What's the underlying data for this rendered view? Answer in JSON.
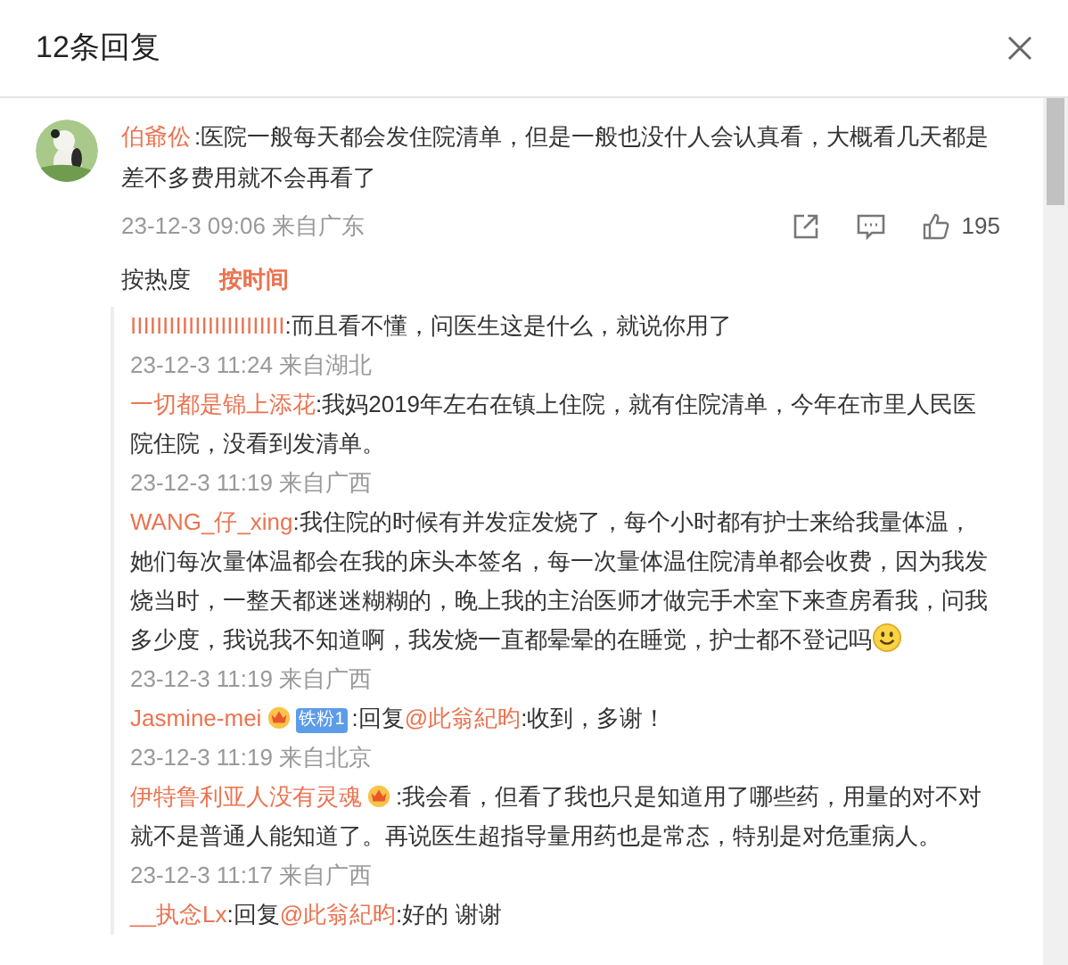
{
  "header": {
    "title": "12条回复"
  },
  "comment": {
    "name": "伯爺伀",
    "text": ":医院一般每天都会发住院清单，但是一般也没什人会认真看，大概看几天都是差不多费用就不会再看了",
    "time": "23-12-3 09:06 来自广东",
    "likes": "195"
  },
  "sort_tabs": [
    {
      "label": "按热度",
      "selected": false
    },
    {
      "label": "按时间",
      "selected": true
    }
  ],
  "replies": [
    {
      "name": "IIIIIIIIIIIIIIIIIIIIIIII",
      "text": ":而且看不懂，问医生这是什么，就说你用了",
      "time": "23-12-3 11:24 来自湖北"
    },
    {
      "name": "一切都是锦上添花",
      "text": ":我妈2019年左右在镇上住院，就有住院清单，今年在市里人民医院住院，没看到发清单。",
      "time": "23-12-3 11:19 来自广西"
    },
    {
      "name": "WANG_仔_xing",
      "text": ":我住院的时候有并发症发烧了，每个小时都有护士来给我量体温，她们每次量体温都会在我的床头本签名，每一次量体温住院清单都会收费，因为我发烧当时，一整天都迷迷糊糊的，晚上我的主治医师才做完手术室下来查房看我，问我多少度，我说我不知道啊，我发烧一直都晕晕的在睡觉，护士都不登记吗",
      "emoji": true,
      "time": "23-12-3 11:19 来自广西"
    },
    {
      "name": "Jasmine-mei",
      "crown": true,
      "fan_badge": "铁粉1",
      "reply_prefix": ":回复",
      "reply_to": "@此翁紀昀",
      "text": ":收到，多谢！",
      "time": "23-12-3 11:19 来自北京"
    },
    {
      "name": "伊特鲁利亚人没有灵魂",
      "crown": true,
      "text": ":我会看，但看了我也只是知道用了哪些药，用量的对不对就不是普通人能知道了。再说医生超指导量用药也是常态，特别是对危重病人。",
      "time": "23-12-3 11:17 来自广西"
    },
    {
      "name": "__执念Lx",
      "reply_prefix": ":回复",
      "reply_to": "@此翁紀昀",
      "text": ":好的 谢谢"
    }
  ]
}
